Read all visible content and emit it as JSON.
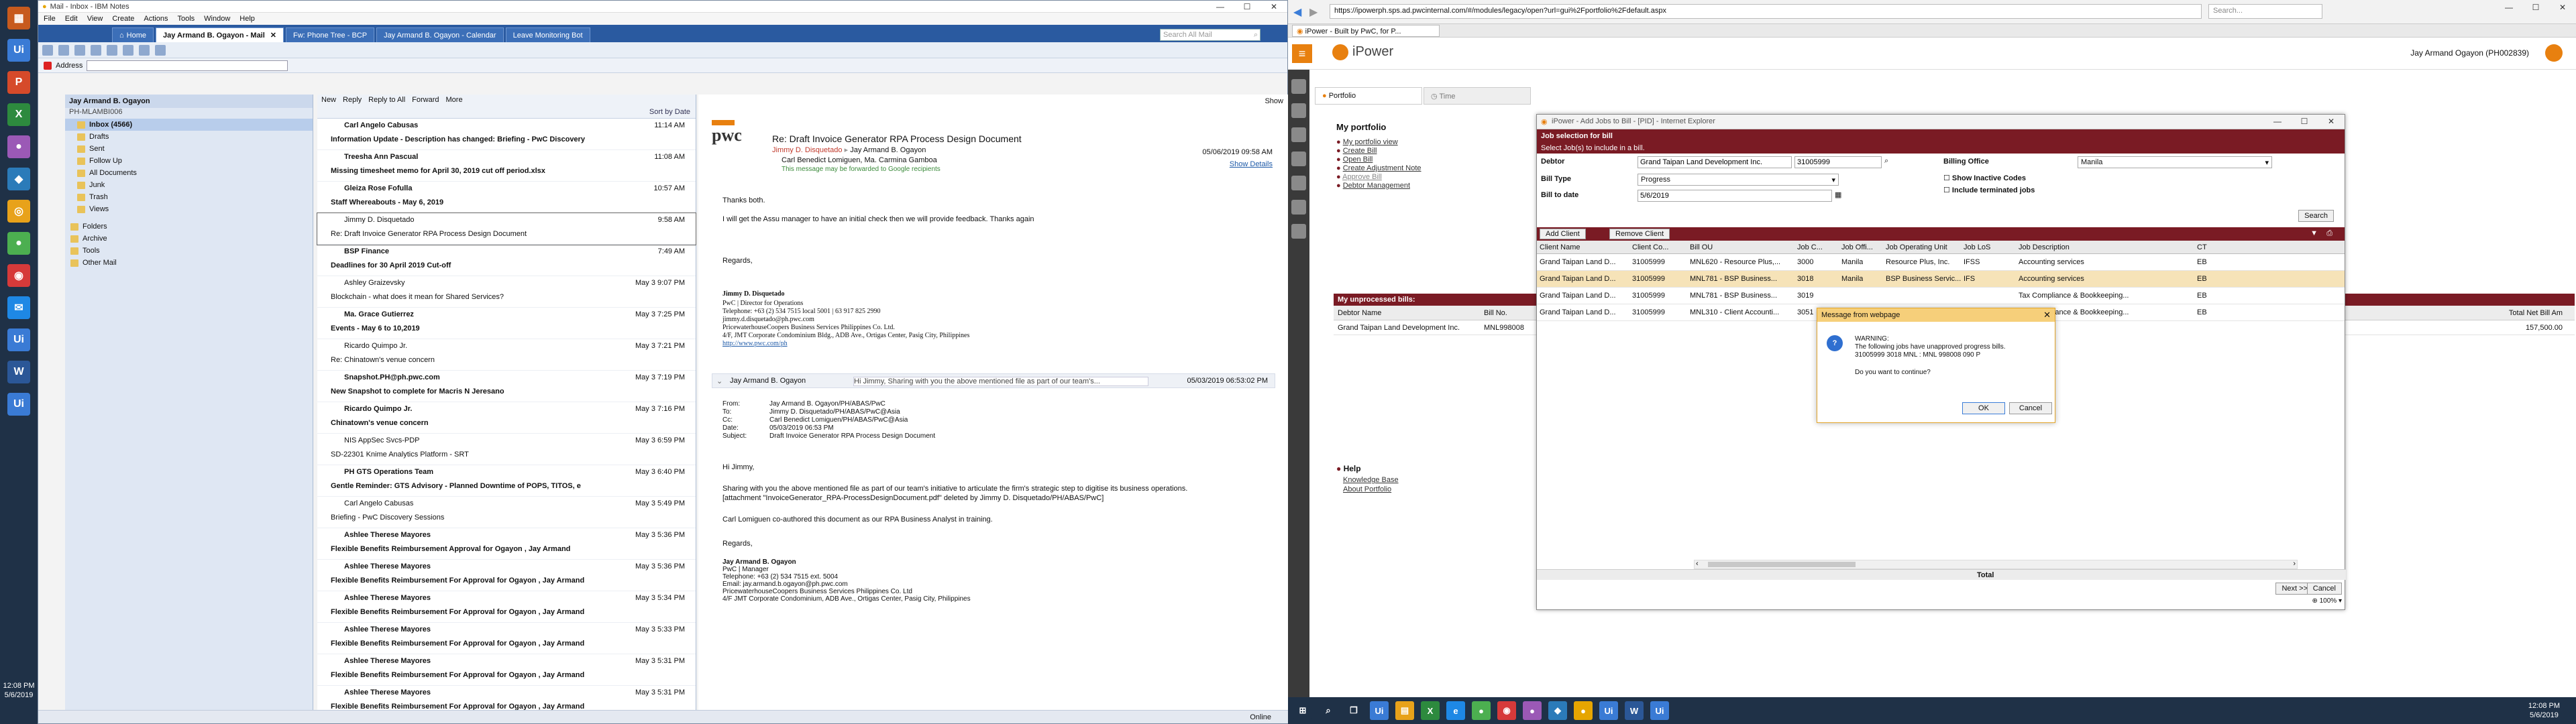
{
  "left_taskbar": {
    "clock_time": "12:08 PM",
    "clock_date": "5/6/2019"
  },
  "notes": {
    "title": "Mail - Inbox - IBM Notes",
    "menus": [
      "File",
      "Edit",
      "View",
      "Create",
      "Actions",
      "Tools",
      "Window",
      "Help"
    ],
    "tabs": [
      "Home",
      "Jay Armand B. Ogayon - Mail",
      "Fw: Phone Tree - BCP",
      "Jay Armand B. Ogayon - Calendar",
      "Leave Monitoring Bot"
    ],
    "search_placeholder": "Search All Mail",
    "address_label": "Address",
    "nav": {
      "owner": "Jay Armand B. Ogayon",
      "sub": "PH-MLAMBI006",
      "items": [
        "Inbox (4566)",
        "Drafts",
        "Sent",
        "Follow Up",
        "All Documents",
        "Junk",
        "Trash",
        "Views",
        "Folders",
        "Archive",
        "Tools",
        "Other Mail"
      ]
    },
    "list_toolbar": {
      "new": "New",
      "reply": "Reply",
      "reply_all": "Reply to All",
      "forward": "Forward",
      "more": "More",
      "show": "Show",
      "sort": "Sort by Date"
    },
    "messages": [
      {
        "sender": "Carl Angelo Cabusas",
        "subject": "Information Update - Description has changed: Briefing - PwC Discovery",
        "date": "11:14 AM",
        "unread": true
      },
      {
        "sender": "Treesha Ann Pascual",
        "subject": "Missing timesheet memo for April 30, 2019 cut off period.xlsx",
        "date": "11:08 AM",
        "unread": true
      },
      {
        "sender": "Gleiza Rose Fofulla",
        "subject": "Staff Whereabouts - May 6, 2019",
        "date": "10:57 AM",
        "unread": true
      },
      {
        "sender": "Jimmy D. Disquetado",
        "subject": "Re: Draft Invoice Generator RPA Process Design Document",
        "date": "9:58 AM",
        "unread": false
      },
      {
        "sender": "BSP Finance",
        "subject": "Deadlines for 30 April 2019 Cut-off",
        "date": "7:49 AM",
        "unread": true
      },
      {
        "sender": "Ashley Graizevsky",
        "subject": "Blockchain - what does it mean for Shared Services?",
        "date": "May 3   9:07 PM",
        "unread": false
      },
      {
        "sender": "Ma. Grace Gutierrez",
        "subject": "Events - May 6 to 10,2019",
        "date": "May 3   7:25 PM",
        "unread": true
      },
      {
        "sender": "Ricardo Quimpo Jr.",
        "subject": "Re: Chinatown's venue concern",
        "date": "May 3   7:21 PM",
        "unread": false
      },
      {
        "sender": "Snapshot.PH@ph.pwc.com",
        "subject": "New Snapshot to complete for Macris N Jeresano",
        "date": "May 3   7:19 PM",
        "unread": true
      },
      {
        "sender": "Ricardo Quimpo Jr.",
        "subject": "Chinatown's venue concern",
        "date": "May 3   7:16 PM",
        "unread": true
      },
      {
        "sender": "NIS AppSec Svcs-PDP",
        "subject": "SD-22301 Knime Analytics Platform - SRT",
        "date": "May 3   6:59 PM",
        "unread": false
      },
      {
        "sender": "PH GTS Operations Team",
        "subject": "Gentle Reminder:  GTS Advisory - Planned Downtime of POPS, TITOS, e",
        "date": "May 3   6:40 PM",
        "unread": true
      },
      {
        "sender": "Carl Angelo Cabusas",
        "subject": "Briefing - PwC Discovery Sessions",
        "date": "May 3   5:49 PM",
        "unread": false
      },
      {
        "sender": "Ashlee Therese Mayores",
        "subject": "Flexible Benefits Reimbursement Approval for Ogayon , Jay Armand",
        "date": "May 3   5:36 PM",
        "unread": true
      },
      {
        "sender": "Ashlee Therese Mayores",
        "subject": "Flexible Benefits Reimbursement For Approval for Ogayon , Jay Armand",
        "date": "May 3   5:36 PM",
        "unread": true
      },
      {
        "sender": "Ashlee Therese Mayores",
        "subject": "Flexible Benefits Reimbursement For Approval for Ogayon , Jay Armand",
        "date": "May 3   5:34 PM",
        "unread": true
      },
      {
        "sender": "Ashlee Therese Mayores",
        "subject": "Flexible Benefits Reimbursement For Approval for Ogayon , Jay Armand",
        "date": "May 3   5:33 PM",
        "unread": true
      },
      {
        "sender": "Ashlee Therese Mayores",
        "subject": "Flexible Benefits Reimbursement For Approval for Ogayon , Jay Armand",
        "date": "May 3   5:31 PM",
        "unread": true
      },
      {
        "sender": "Ashlee Therese Mayores",
        "subject": "Flexible Benefits Reimbursement For Approval for Ogayon , Jay Armand",
        "date": "May 3   5:31 PM",
        "unread": true
      }
    ],
    "preview": {
      "logo": "pwc",
      "subject": "Re: Draft Invoice Generator RPA Process Design Document",
      "from": "Jimmy D. Disquetado",
      "to": "Jay Armand B. Ogayon",
      "cc": "Carl Benedict Lomiguen, Ma. Carmina Gamboa",
      "date": "05/06/2019 09:58 AM",
      "show_details": "Show Details",
      "notice": "This message may be forwarded to Google recipients",
      "body1": "Thanks both.",
      "body2": "I will get the Assu manager to have an initial check then we will provide feedback. Thanks again",
      "regards": "Regards,",
      "sig_name": "Jimmy D. Disquetado",
      "sig_lines": [
        "PwC | Director for Operations",
        "Telephone: +63 (2) 534 7515 local 5001 | 63 917 825 2990",
        "jimmy.d.disquetado@ph.pwc.com",
        "PricewaterhouseCoopers Business Services Philippines Co. Ltd.",
        "4/F, JMT Corporate Condominium Bldg., ADB Ave., Ortigas Center, Pasig City, Philippines",
        "http://www.pwc.com/ph"
      ],
      "thread_from": "Jay Armand B. Ogayon",
      "thread_snippet": "Hi Jimmy, Sharing with you the above mentioned file as part of our team's...",
      "thread_date": "05/03/2019 06:53:02 PM",
      "hdr_labels": [
        "From:",
        "To:",
        "Cc:",
        "Date:",
        "Subject:"
      ],
      "hdr_values": [
        "Jay Armand B. Ogayon/PH/ABAS/PwC",
        "Jimmy D. Disquetado/PH/ABAS/PwC@Asia",
        "Carl Benedict Lomiguen/PH/ABAS/PwC@Asia",
        "05/03/2019 06:53 PM",
        "Draft Invoice Generator RPA Process Design Document"
      ],
      "q_greet": "Hi Jimmy,",
      "q_body": "Sharing with you the above mentioned file as part of our team's initiative to articulate the firm's strategic step to digitise its business operations.",
      "q_attach": "[attachment \"InvoiceGenerator_RPA-ProcessDesignDocument.pdf\" deleted by Jimmy D. Disquetado/PH/ABAS/PwC]",
      "q_co": "Carl Lomiguen co-authored this document as our RPA Business Analyst in training.",
      "q_regards": "Regards,",
      "q_sig": [
        "Jay Armand B. Ogayon",
        "PwC | Manager",
        "Telephone: +63 (2) 534 7515 ext. 5004",
        "Email: jay.armand.b.ogayon@ph.pwc.com",
        "PricewaterhouseCoopers Business Services Philippines Co. Ltd",
        "4/F JMT Corporate Condominium, ADB Ave., Ortigas Center, Pasig City, Philippines"
      ]
    },
    "status_right": "Online"
  },
  "browser": {
    "url": "https://ipowerph.sps.ad.pwcinternal.com/#/modules/legacy/open?url=gui%2Fportfolio%2Fdefault.aspx",
    "tab_title": "iPower - Built by PwC, for P...",
    "search_placeholder": "Search...",
    "brand": "iPower",
    "user": "Jay Armand Ogayon (PH002839)",
    "tabs": [
      "Portfolio",
      "Time"
    ],
    "portfolio_title": "My portfolio",
    "links": [
      "My portfolio view",
      "Create Bill",
      "Open Bill",
      "Create Adjustment Note",
      "Approve Bill",
      "Debtor Management"
    ],
    "unprocessed_title": "My unprocessed bills:",
    "unproc_cols": [
      "Debtor Name",
      "Bill No."
    ],
    "unproc_row": [
      "Grand Taipan Land Development Inc.",
      "MNL998008"
    ],
    "unproc_right_col": "Total Net Bill Am",
    "unproc_right_val": "157,500.00",
    "help_title": "Help",
    "help_links": [
      "Knowledge Base",
      "About Portfolio"
    ]
  },
  "dialog": {
    "title": "iPower - Add Jobs to Bill - [PID] - Internet Explorer",
    "band": "Job selection for bill",
    "sub": "Select Job(s) to include in a bill.",
    "debtor_label": "Debtor",
    "debtor_value": "Grand Taipan Land Development Inc.",
    "debtor_code": "31005999",
    "billing_office_label": "Billing Office",
    "billing_office_value": "Manila",
    "bill_type_label": "Bill Type",
    "bill_type_value": "Progress",
    "bill_date_label": "Bill to date",
    "bill_date_value": "5/6/2019",
    "chk1": "Show Inactive Codes",
    "chk2": "Include terminated jobs",
    "search_btn": "Search",
    "add_client": "Add Client",
    "remove_client": "Remove Client",
    "cols": [
      "Client Name",
      "Client Co...",
      "Bill OU",
      "Job C...",
      "Job Offi...",
      "Job Operating Unit",
      "Job LoS",
      "Job Description",
      "CT"
    ],
    "rows": [
      [
        "Grand Taipan Land D...",
        "31005999",
        "MNL620 - Resource Plus,...",
        "3000",
        "Manila",
        "Resource Plus, Inc.",
        "IFSS",
        "Accounting services",
        "EB"
      ],
      [
        "Grand Taipan Land D...",
        "31005999",
        "MNL781 - BSP Business...",
        "3018",
        "Manila",
        "BSP Business Servic...",
        "IFS",
        "Accounting services",
        "EB"
      ],
      [
        "Grand Taipan Land D...",
        "31005999",
        "MNL781 - BSP Business...",
        "3019",
        "",
        "",
        "",
        "Tax Compliance & Bookkeeping...",
        "EB"
      ],
      [
        "Grand Taipan Land D...",
        "31005999",
        "MNL310 - Client Accounti...",
        "3051",
        "",
        "",
        "",
        "Tax Compliance & Bookkeeping...",
        "EB"
      ]
    ],
    "total_label": "Total",
    "next_btn": "Next >>",
    "cancel_btn": "Cancel",
    "zoom": "100%"
  },
  "msgbox": {
    "title": "Message from webpage",
    "line1": "WARNING:",
    "line2": "The following jobs have unapproved progress bills.",
    "line3": "31005999 3018 MNL : MNL 998008 090 P",
    "line4": "Do you want to continue?",
    "ok": "OK",
    "cancel": "Cancel"
  },
  "right_taskbar": {
    "clock_time": "12:08 PM",
    "clock_date": "5/6/2019"
  },
  "colors": {
    "notes_blue": "#2a5aa0",
    "ipower_red": "#7a1b24",
    "ipower_orange": "#e8800f",
    "taskbar": "#1f3147"
  }
}
